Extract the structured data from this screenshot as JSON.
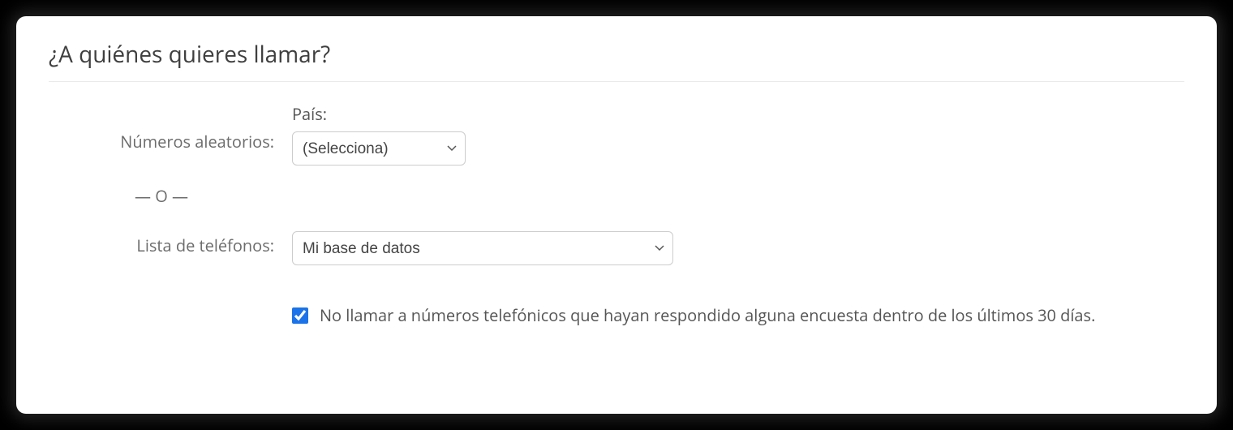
{
  "panel": {
    "title": "¿A quiénes quieres llamar?"
  },
  "form": {
    "random_numbers_label": "Números aleatorios:",
    "country_sublabel": "País:",
    "country_selected": "(Selecciona)",
    "separator": "— O —",
    "phone_list_label": "Lista de teléfonos:",
    "phone_list_selected": "Mi base de datos",
    "exclude_checkbox_label": "No llamar a números telefónicos que hayan respondido alguna encuesta dentro de los últimos 30 días.",
    "exclude_checked": true
  }
}
